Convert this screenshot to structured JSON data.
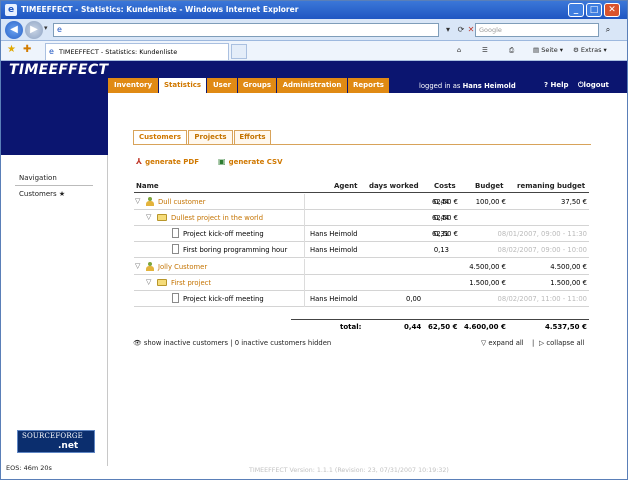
{
  "window": {
    "title": "TIMEEFFECT - Statistics: Kundenliste - Windows Internet Explorer",
    "app_icon": "e",
    "minimize": "_",
    "maximize": "□",
    "close": "✕"
  },
  "browser": {
    "back": "◀",
    "forward": "▶",
    "dropdown": "▾",
    "address_value": "",
    "search_placeholder": "Google",
    "tab_title": "TIMEEFFECT - Statistics: Kundenliste",
    "icons": [
      "ie-page-icon",
      "refresh-icon",
      "stop-icon",
      "search-icon",
      "favorites-star-icon",
      "add-favorite-icon",
      "home-icon",
      "feeds-icon",
      "print-icon"
    ],
    "commands": {
      "page": "Seite",
      "extras": "Extras"
    }
  },
  "app": {
    "logo": "TIMEEFFECT",
    "nav": [
      "Inventory",
      "Statistics",
      "User",
      "Groups",
      "Administration",
      "Reports"
    ],
    "active_nav": "Statistics",
    "logged_in_label": "logged in as",
    "user": "Hans Heimold",
    "help": "Help",
    "logout": "logout",
    "help_icon": "?",
    "logout_icon": "⏻"
  },
  "sidebar": {
    "navigation_label": "Navigation",
    "customers_label": "Customers",
    "customers_marker": "★",
    "sourceforge_line1": "SOURCEFORGE",
    "sourceforge_line2": ".net",
    "eos": "EOS: 46m 20s"
  },
  "subtabs": [
    "Customers",
    "Projects",
    "Efforts"
  ],
  "actions": {
    "pdf": "generate PDF",
    "csv": "generate CSV",
    "pdf_icon": "⅄",
    "csv_icon": "▣"
  },
  "table": {
    "headers": [
      "Name",
      "Agent",
      "days worked",
      "Costs",
      "Budget",
      "remaning budget"
    ],
    "rows": [
      {
        "level": 0,
        "type": "customer",
        "twisty": "▽",
        "name": "Dull customer",
        "agent": "",
        "days": "0,44",
        "costs": "62,50 €",
        "budget": "100,00 €",
        "remaining": "37,50 €",
        "date": ""
      },
      {
        "level": 1,
        "type": "project",
        "twisty": "▽",
        "name": "Dullest project in the world",
        "agent": "",
        "days": "0,44",
        "costs": "62,50 €",
        "budget": "",
        "remaining": "",
        "date": ""
      },
      {
        "level": 2,
        "type": "effort",
        "twisty": "",
        "name": "Project kick-off meeting",
        "agent": "Hans Heimold",
        "days": "0,31",
        "costs": "62,50 €",
        "budget": "",
        "remaining": "",
        "date": "08/01/2007, 09:00 - 11:30"
      },
      {
        "level": 2,
        "type": "effort",
        "twisty": "",
        "name": "First boring programming hour",
        "agent": "Hans Heimold",
        "days": "0,13",
        "costs": "",
        "budget": "",
        "remaining": "",
        "date": "08/02/2007, 09:00 - 10:00"
      },
      {
        "level": 0,
        "type": "customer",
        "twisty": "▽",
        "name": "Jolly Customer",
        "agent": "",
        "days": "",
        "costs": "",
        "budget": "4.500,00 €",
        "remaining": "4.500,00 €",
        "date": ""
      },
      {
        "level": 1,
        "type": "project",
        "twisty": "▽",
        "name": "First project",
        "agent": "",
        "days": "",
        "costs": "",
        "budget": "1.500,00 €",
        "remaining": "1.500,00 €",
        "date": ""
      },
      {
        "level": 2,
        "type": "effort",
        "twisty": "",
        "name": "Project kick-off meeting",
        "agent": "Hans Heimold",
        "days": "0,00",
        "costs": "",
        "budget": "",
        "remaining": "",
        "date": "08/02/2007, 11:00 - 11:00"
      }
    ],
    "total": {
      "label": "total:",
      "days": "0,44",
      "costs": "62,50 €",
      "budget": "4.600,00 €",
      "remaining": "4.537,50 €"
    }
  },
  "footer": {
    "inactive_icon": "👁",
    "inactive_text": "show inactive customers | 0 inactive customers hidden",
    "expand_all": "expand all",
    "collapse_all": "collapse all",
    "expand_icon": "▽",
    "collapse_icon": "▷",
    "separator": "|"
  },
  "version": "TIMEEFFECT Version: 1.1.1 (Revision: 23, 07/31/2007 10:19:32)"
}
